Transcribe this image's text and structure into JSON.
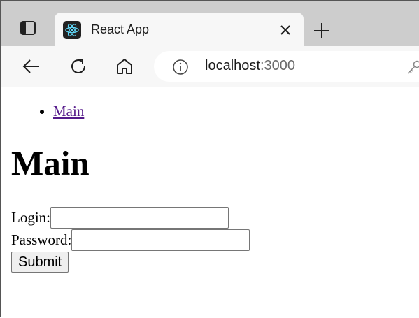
{
  "browser": {
    "tab_title": "React App",
    "url_host": "localhost",
    "url_port": ":3000"
  },
  "nav": {
    "items": [
      {
        "label": "Main"
      }
    ]
  },
  "page": {
    "heading": "Main",
    "login_label": "Login:",
    "login_value": "",
    "password_label": "Password:",
    "password_value": "",
    "submit_label": "Submit"
  },
  "icons": {
    "tab_actions": "tab-actions-icon",
    "favicon": "react-logo-icon",
    "close": "close-icon",
    "new_tab": "plus-icon",
    "back": "back-arrow-icon",
    "refresh": "refresh-icon",
    "home": "home-icon",
    "info": "info-icon",
    "key": "key-icon"
  },
  "colors": {
    "tabstrip": "#cdcdcd",
    "toolbar": "#f7f7f7",
    "link_visited": "#551a8b",
    "react_logo": "#61dafb"
  }
}
